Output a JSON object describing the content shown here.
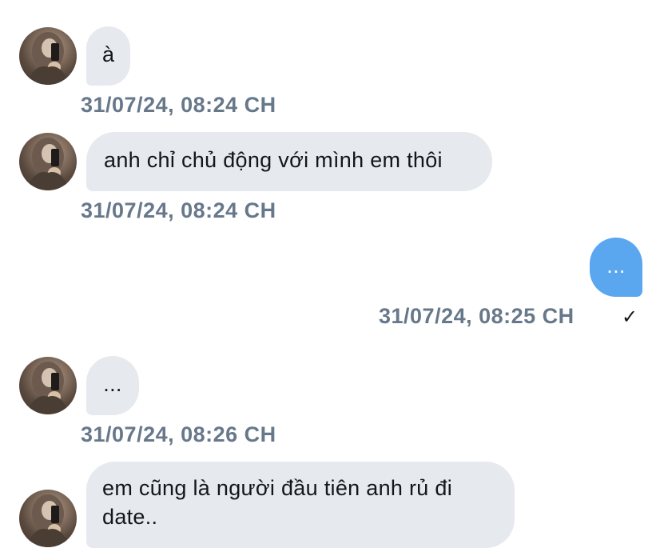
{
  "messages": [
    {
      "text": "à",
      "timestamp": "31/07/24, 08:24 CH"
    },
    {
      "text": "anh chỉ chủ động với mình em thôi",
      "timestamp": "31/07/24, 08:24 CH"
    },
    {
      "text": "...",
      "timestamp": "31/07/24, 08:25 CH",
      "status_icon": "✓"
    },
    {
      "text": "...",
      "timestamp": "31/07/24, 08:26 CH"
    },
    {
      "text_line1": "em cũng là người đầu tiên anh rủ đi",
      "text_line2": "date.."
    }
  ],
  "colors": {
    "received_bubble": "#e6e9ed",
    "sent_bubble": "#5aa6ef",
    "timestamp": "#67788a"
  }
}
